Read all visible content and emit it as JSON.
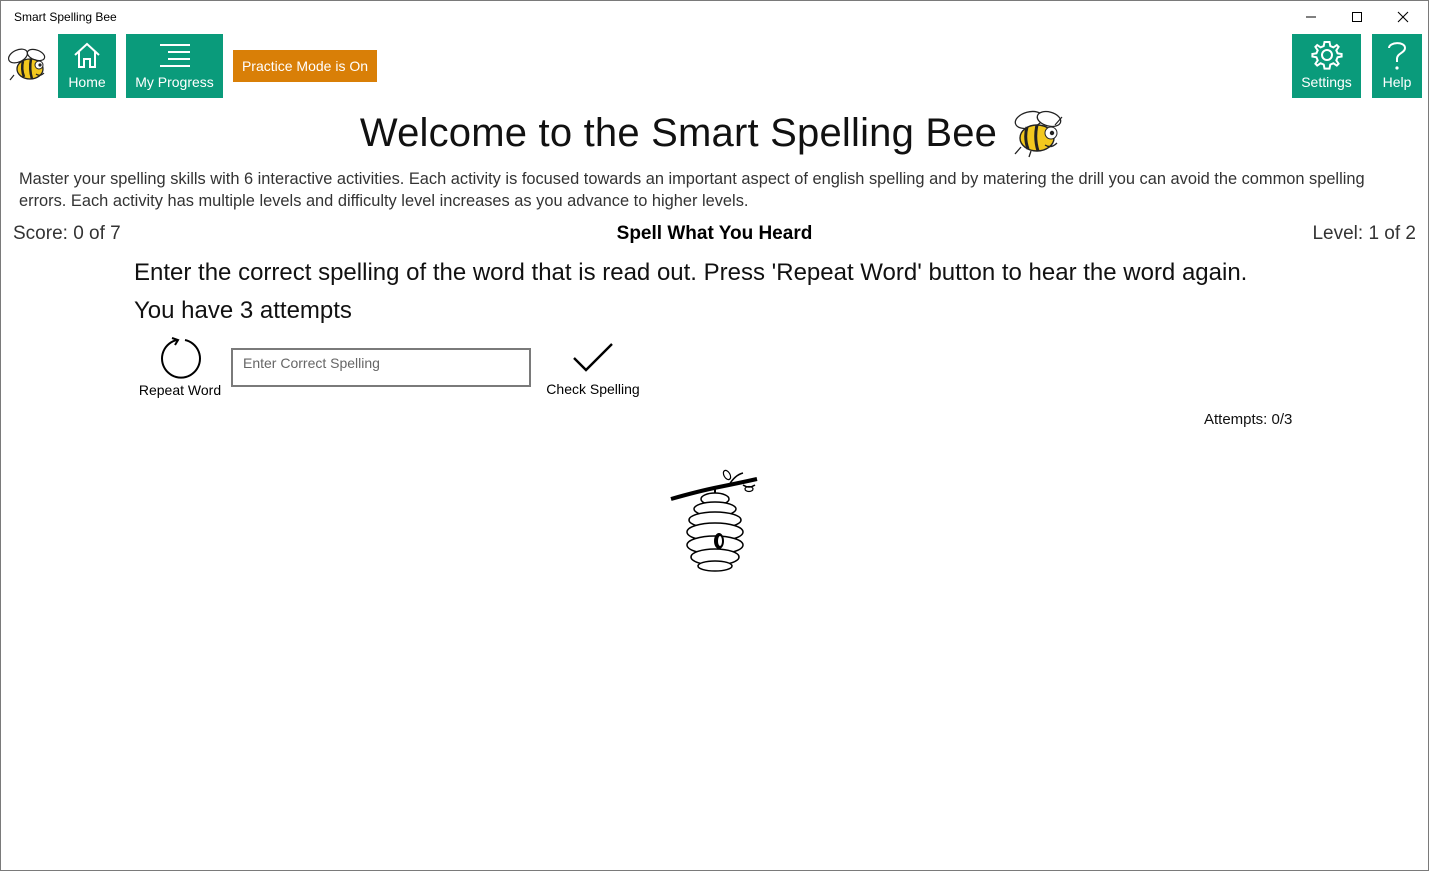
{
  "window": {
    "title": "Smart Spelling Bee"
  },
  "toolbar": {
    "home_label": "Home",
    "progress_label": "My Progress",
    "practice_badge": "Practice Mode is On",
    "settings_label": "Settings",
    "help_label": "Help"
  },
  "colors": {
    "nav_button": "#0a9b7b",
    "practice_badge": "#d97f07"
  },
  "icons": [
    "bee-logo-icon",
    "home-icon",
    "list-icon",
    "gear-icon",
    "question-icon",
    "refresh-icon",
    "checkmark-icon",
    "beehive-icon",
    "bee-icon"
  ],
  "main": {
    "welcome": "Welcome to the Smart Spelling Bee",
    "intro": "Master your spelling skills with 6 interactive activities. Each activity is focused towards an important aspect of english spelling and by matering the drill you can avoid the common spelling errors. Each activity has multiple levels and difficulty level increases as you advance to higher levels.",
    "score": "Score: 0 of 7",
    "activity_title": "Spell What You Heard",
    "level": "Level: 1 of 2",
    "instruction": "Enter the correct spelling of the word that is read out. Press 'Repeat Word' button to hear the word again.",
    "attempts_info": "You have 3 attempts",
    "repeat_label": "Repeat Word",
    "input_value": "",
    "input_placeholder": "Enter Correct Spelling",
    "check_label": "Check Spelling",
    "attempt_count": "Attempts: 0/3"
  }
}
